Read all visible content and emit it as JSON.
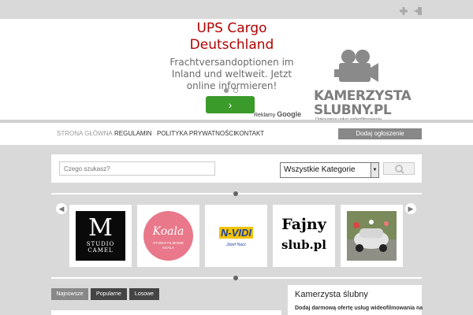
{
  "top_icons": [
    "add-icon",
    "login-icon"
  ],
  "ad": {
    "title_line1": "UPS Cargo",
    "title_line2": "Deutschland",
    "subtitle_line1": "Frachtversandoptionen im",
    "subtitle_line2": "Inland und weltweit. Jetzt",
    "subtitle_line3": "online informieren!",
    "button_label": "›",
    "sponsored_label": "Reklamy",
    "sponsor_brand": "Google",
    "dots": 2
  },
  "logo": {
    "line1": "KAMERZYSTA",
    "line2": "SLUBNY.PL",
    "tagline": "Ogłoszenia usług wideofilmowania"
  },
  "nav": {
    "items": [
      "STRONA GŁÓWNA",
      "REGULAMIN",
      "POLITYKA PRYWATNOŚCI",
      "KONTAKT"
    ],
    "active_index": 0,
    "add_button": "Dodaj ogłoszenie"
  },
  "search": {
    "placeholder": "Czego szukasz?",
    "category_selected": "Wszystkie Kategorie"
  },
  "carousel": {
    "items": [
      {
        "name": "Studio Camel",
        "text1": "M",
        "text2": "STUDIO",
        "text3": "CAMEL"
      },
      {
        "name": "Koala",
        "text1": "Koala",
        "text2": "STUDIO FILMOWE KOALA"
      },
      {
        "name": "N-VIDI",
        "text1": "N-VIDI",
        "text2": "Józef Nacz"
      },
      {
        "name": "Fajny slub",
        "text1": "Fajny",
        "text2": "slub.pl"
      },
      {
        "name": "Wedding car",
        "text1": ""
      }
    ]
  },
  "tabs": [
    "Najnowsze",
    "Popularne",
    "Losowe"
  ],
  "active_tab": 0,
  "sidebar": {
    "title": "Kamerzysta ślubny",
    "text": "Dodaj darmową ofertę usług wideofilmowania na"
  },
  "colors": {
    "ad_title": "#b30000",
    "ad_button": "#3a9a2a",
    "background": "#d9d9d9"
  }
}
